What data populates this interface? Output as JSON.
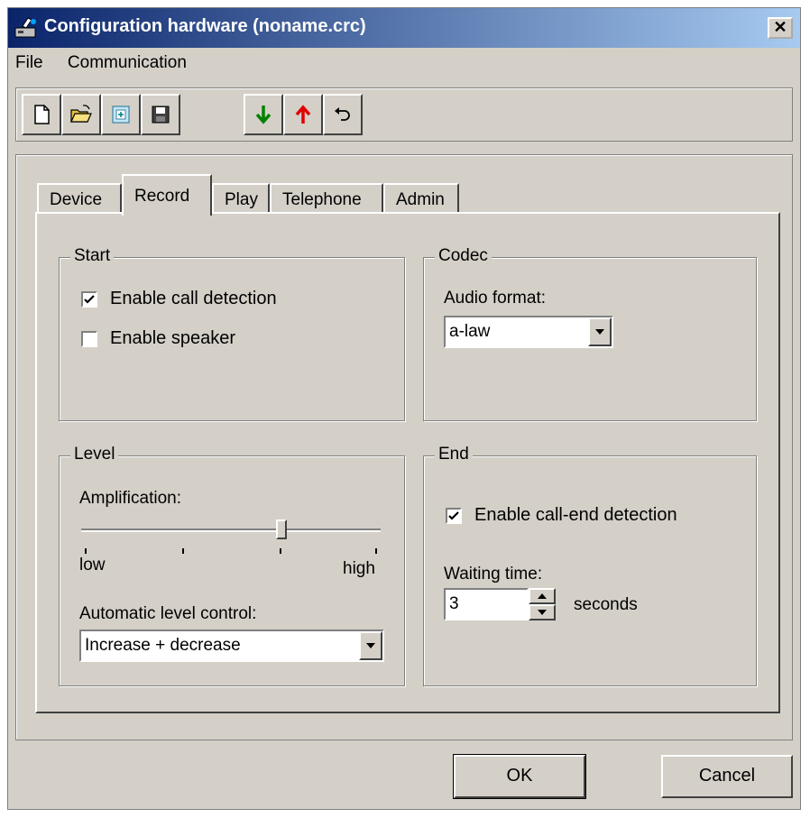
{
  "window": {
    "title": "Configuration hardware (noname.crc)",
    "close_label": "✕"
  },
  "menu": {
    "file": "File",
    "communication": "Communication"
  },
  "toolbar": {
    "buttons_group1": [
      "new-file-icon",
      "open-folder-icon",
      "import-icon",
      "save-icon"
    ],
    "buttons_group2": [
      "download-arrow-icon",
      "upload-arrow-icon",
      "undo-icon"
    ]
  },
  "tabs": [
    {
      "label": "Device",
      "active": false
    },
    {
      "label": "Record",
      "active": true
    },
    {
      "label": "Play",
      "active": false
    },
    {
      "label": "Telephone",
      "active": false
    },
    {
      "label": "Admin",
      "active": false
    }
  ],
  "start": {
    "title": "Start",
    "call_detection_label": "Enable call detection",
    "call_detection_checked": true,
    "speaker_label": "Enable speaker",
    "speaker_checked": false
  },
  "codec": {
    "title": "Codec",
    "audio_format_label": "Audio format:",
    "audio_format_value": "a-law"
  },
  "level": {
    "title": "Level",
    "amplification_label": "Amplification:",
    "amplification_fraction": 0.67,
    "low_label": "low",
    "high_label": "high",
    "alc_label": "Automatic level control:",
    "alc_value": "Increase + decrease"
  },
  "end": {
    "title": "End",
    "call_end_label": "Enable call-end detection",
    "call_end_checked": true,
    "waiting_label": "Waiting time:",
    "waiting_value": "3",
    "seconds_label": "seconds"
  },
  "buttons": {
    "ok": "OK",
    "cancel": "Cancel"
  },
  "colors": {
    "title_start": "#0a246a",
    "title_end": "#a6caf0",
    "face": "#d4d0c8",
    "green_arrow": "#008000",
    "red_arrow": "#e00000"
  }
}
